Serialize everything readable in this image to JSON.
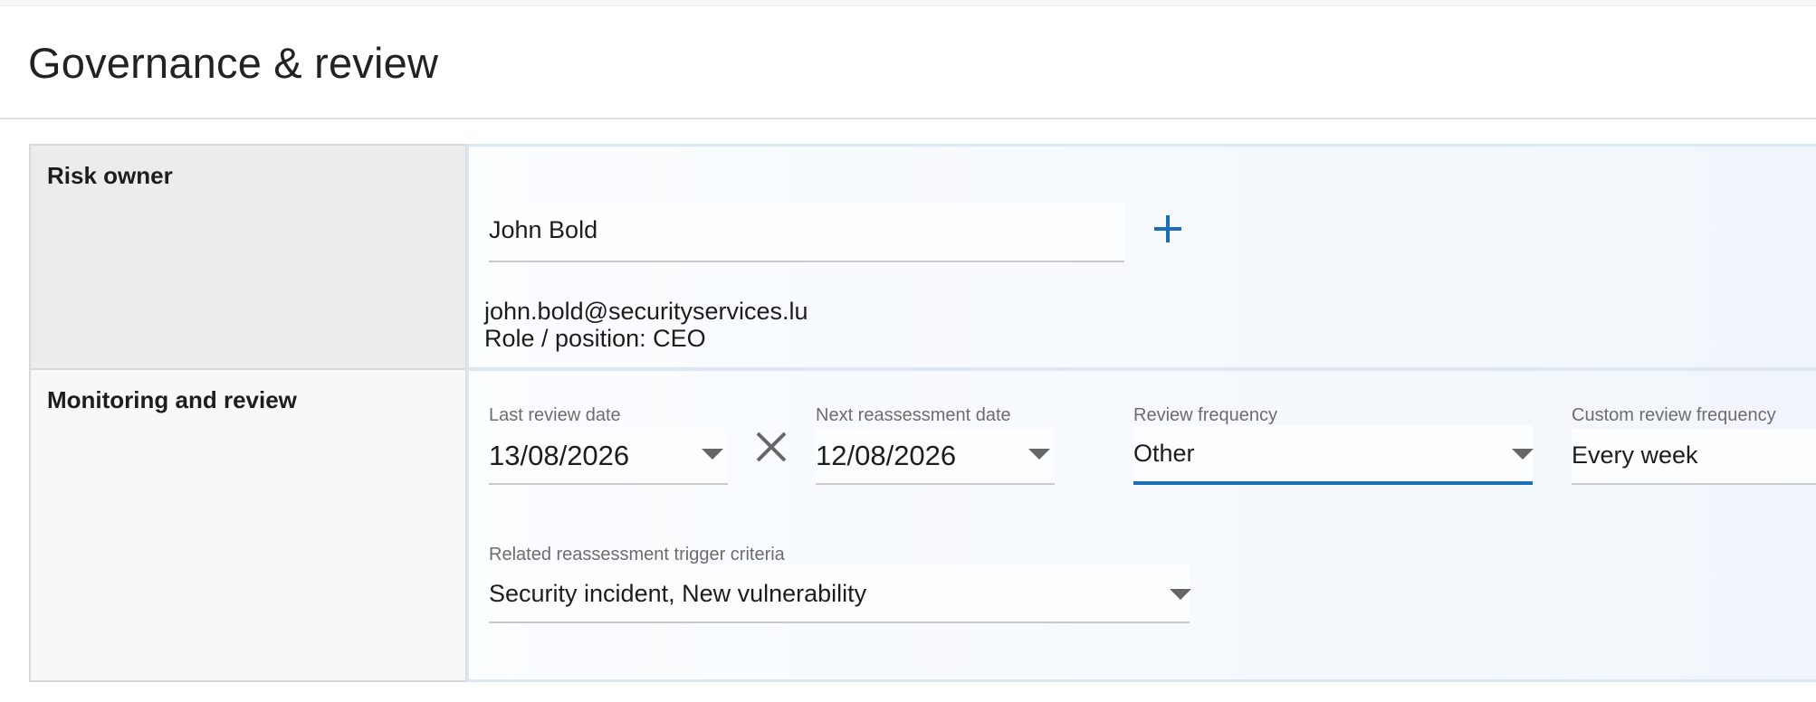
{
  "page": {
    "title": "Governance & review"
  },
  "risk_owner": {
    "label": "Risk owner",
    "owner_name": "John Bold",
    "add_icon": "plus-icon",
    "email": "john.bold@securityservices.lu",
    "role": "Role / position: CEO"
  },
  "monitoring": {
    "label": "Monitoring and review",
    "last_review": {
      "label": "Last review date",
      "value": "13/08/2026",
      "clear_icon": "close-icon"
    },
    "next_reassessment": {
      "label": "Next reassessment date",
      "value": "12/08/2026"
    },
    "review_frequency": {
      "label": "Review frequency",
      "value": "Other"
    },
    "custom_frequency": {
      "label": "Custom review frequency",
      "value": "Every week"
    },
    "trigger_criteria": {
      "label": "Related reassessment trigger criteria",
      "value": "Security incident, New vulnerability"
    }
  },
  "colors": {
    "accent": "#1a6fb8",
    "label_cell_bg": "#ececec",
    "content_bg": "#f1f6fc",
    "field_label": "#6d6d6d"
  }
}
